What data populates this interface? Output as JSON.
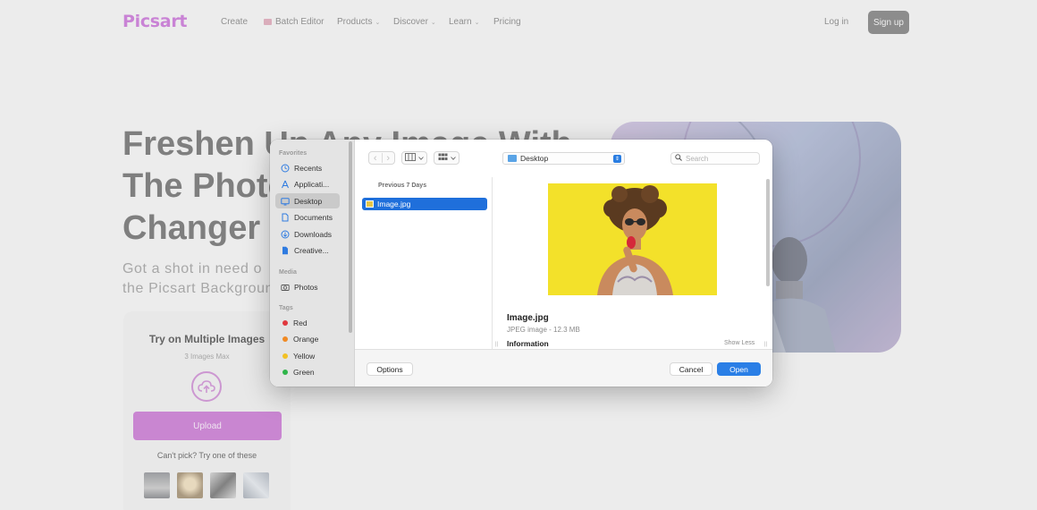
{
  "nav": {
    "logo": "Picsart",
    "items": [
      {
        "label": "Create",
        "caret": false
      },
      {
        "label": "Batch Editor",
        "caret": false
      },
      {
        "label": "Products",
        "caret": true
      },
      {
        "label": "Discover",
        "caret": true
      },
      {
        "label": "Learn",
        "caret": true
      },
      {
        "label": "Pricing",
        "caret": false
      }
    ],
    "login": "Log in",
    "signup": "Sign up",
    "caret_glyph": "⌄"
  },
  "hero": {
    "title_lines": [
      "Freshen Up Any Image With",
      "The Photo",
      "Changer T"
    ],
    "subtitle_lines": [
      "Got a shot in need o",
      "the Picsart Backgroun"
    ]
  },
  "try_card": {
    "title": "Try on Multiple Images",
    "max_note": "3 Images Max",
    "upload_label": "Upload",
    "pick_text": "Can't pick? Try one of these"
  },
  "dialog": {
    "sidebar": {
      "favorites_header": "Favorites",
      "favorites": [
        {
          "label": "Recents",
          "icon": "clock-icon"
        },
        {
          "label": "Applicati...",
          "icon": "applications-icon"
        },
        {
          "label": "Desktop",
          "icon": "desktop-icon",
          "selected": true
        },
        {
          "label": "Documents",
          "icon": "document-icon"
        },
        {
          "label": "Downloads",
          "icon": "download-icon"
        },
        {
          "label": "Creative...",
          "icon": "file-icon"
        }
      ],
      "media_header": "Media",
      "media": [
        {
          "label": "Photos",
          "icon": "camera-icon"
        }
      ],
      "tags_header": "Tags",
      "tags": [
        {
          "label": "Red",
          "color": "#e0383e"
        },
        {
          "label": "Orange",
          "color": "#f08a24"
        },
        {
          "label": "Yellow",
          "color": "#f2c124"
        },
        {
          "label": "Green",
          "color": "#2fb54a"
        }
      ]
    },
    "toolbar": {
      "location": "Desktop",
      "search_placeholder": "Search",
      "back_glyph": "‹",
      "forward_glyph": "›",
      "stepper_glyph": "⇕"
    },
    "browser": {
      "group_header": "Previous 7 Days",
      "files": [
        {
          "name": "Image.jpg",
          "selected": true
        }
      ]
    },
    "preview": {
      "name": "Image.jpg",
      "meta": "JPEG image - 12.3 MB",
      "info_header": "Information",
      "show_less": "Show Less"
    },
    "buttons": {
      "options": "Options",
      "cancel": "Cancel",
      "open": "Open"
    }
  },
  "colors": {
    "brand": "#c56fd3",
    "upload": "#c573cf",
    "selection": "#1f6fdb",
    "primary_button": "#2a7fe6",
    "photo_background": "#f3e12a"
  }
}
